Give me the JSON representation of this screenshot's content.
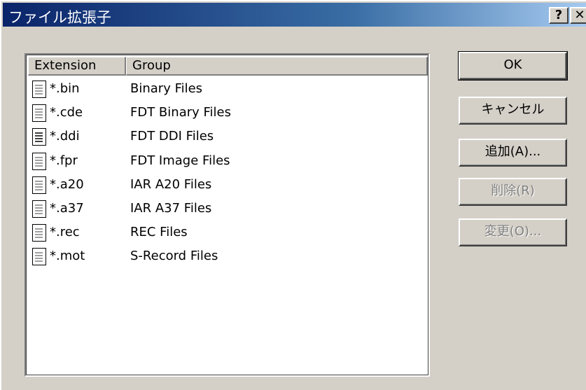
{
  "window": {
    "title": "ファイル拡張子",
    "help_glyph": "?",
    "close_glyph": "✕"
  },
  "list": {
    "columns": [
      "Extension",
      "Group"
    ],
    "rows": [
      {
        "ext": "*.bin",
        "group": "Binary Files",
        "icon": "document-icon"
      },
      {
        "ext": "*.cde",
        "group": "FDT Binary Files",
        "icon": "document-icon"
      },
      {
        "ext": "*.ddi",
        "group": "FDT DDI Files",
        "icon": "text-document-icon"
      },
      {
        "ext": "*.fpr",
        "group": "FDT Image Files",
        "icon": "document-icon"
      },
      {
        "ext": "*.a20",
        "group": "IAR A20 Files",
        "icon": "document-icon"
      },
      {
        "ext": "*.a37",
        "group": "IAR A37 Files",
        "icon": "document-icon"
      },
      {
        "ext": "*.rec",
        "group": "REC Files",
        "icon": "document-icon"
      },
      {
        "ext": "*.mot",
        "group": "S-Record Files",
        "icon": "document-icon"
      }
    ]
  },
  "buttons": {
    "ok": "OK",
    "cancel": "キャンセル",
    "add": "追加(A)...",
    "delete": "削除(R)",
    "change": "変更(O)..."
  },
  "colors": {
    "title_start": "#0a246a",
    "title_end": "#a6caf0",
    "face": "#d4d0c8",
    "disabled_text": "#808080"
  }
}
